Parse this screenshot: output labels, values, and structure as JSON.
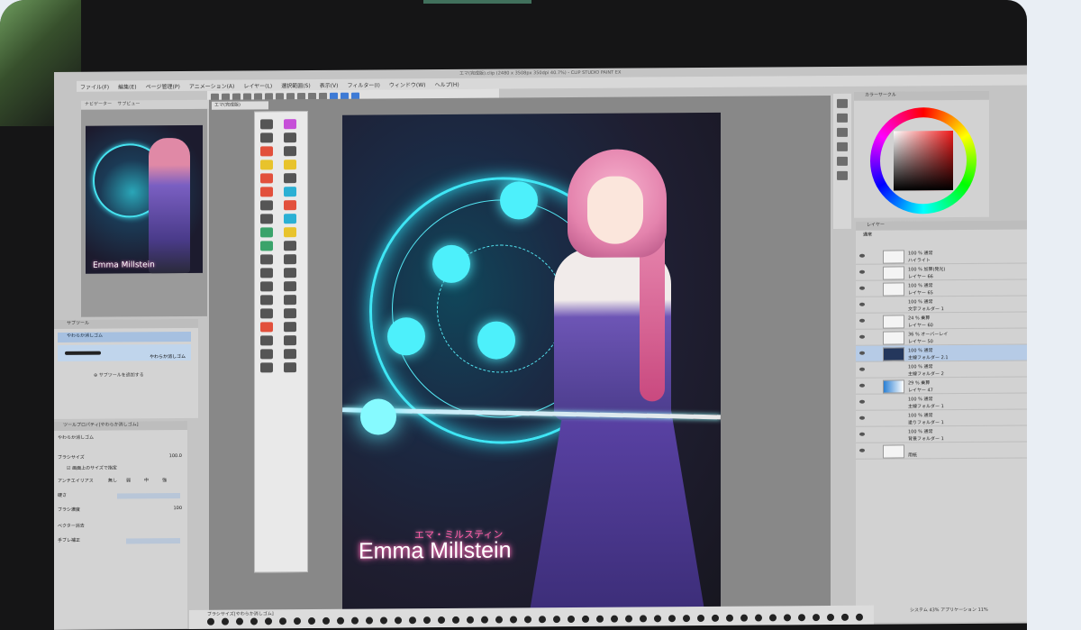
{
  "window": {
    "title": "エマ(完成版).clip (2480 x 3508px 350dpi 40.7%)  - CLIP STUDIO PAINT EX"
  },
  "menubar": {
    "items": [
      "ファイル(F)",
      "編集(E)",
      "ページ管理(P)",
      "アニメーション(A)",
      "レイヤー(L)",
      "選択範囲(S)",
      "表示(V)",
      "フィルター(I)",
      "ウィンドウ(W)",
      "ヘルプ(H)"
    ]
  },
  "navigator": {
    "tabs": [
      "ナビゲーター",
      "サブビュー"
    ],
    "thumb_name": "Emma Millstein"
  },
  "document": {
    "tab": "エマ(完成版)"
  },
  "subtool": {
    "header": "サブツール",
    "selected": "やわらか消しゴム",
    "selected_detail": "やわらか消しゴム",
    "add_button": "サブツールを追加する"
  },
  "tool_property": {
    "header": "ツールプロパティ[やわらか消しゴム]",
    "tool_name": "やわらか消しゴム",
    "brush_size_label": "ブラシサイズ",
    "brush_size_value": "100.0",
    "screen_size_label": "画面上のサイズで指定",
    "antialias_label": "アンチエイリアス",
    "antialias_options": [
      "無し",
      "弱",
      "中",
      "強"
    ],
    "hardness_label": "硬さ",
    "density_label": "ブラシ濃度",
    "density_value": "100",
    "vector_label": "ベクター消去",
    "stabilize_label": "手ブレ補正"
  },
  "artwork": {
    "jp_title": "エマ・ミルスティン",
    "title": "Emma Millstein"
  },
  "color_panel": {
    "header": "カラーサークル"
  },
  "layers": {
    "header": "レイヤー",
    "blend_mode": "通常",
    "rows": [
      {
        "mode": "100 % 通常",
        "name": "ハイライト"
      },
      {
        "mode": "100 % 加算(発光)",
        "name": "レイヤー 66"
      },
      {
        "mode": "100 % 通常",
        "name": "レイヤー 65"
      },
      {
        "mode": "100 % 通常",
        "name": "文字フォルダー 1"
      },
      {
        "mode": "24 % 乗算",
        "name": "レイヤー 60"
      },
      {
        "mode": "36 % オーバーレイ",
        "name": "レイヤー 50"
      },
      {
        "mode": "100 % 通常",
        "name": "主線フォルダー 2.1"
      },
      {
        "mode": "100 % 通常",
        "name": "主線フォルダー 2"
      },
      {
        "mode": "29 % 乗算",
        "name": "レイヤー 47"
      },
      {
        "mode": "100 % 通常",
        "name": "主線フォルダー 1"
      },
      {
        "mode": "100 % 通常",
        "name": "塗りフォルダー 1"
      },
      {
        "mode": "100 % 通常",
        "name": "背景フォルダー 1"
      },
      {
        "mode": "",
        "name": "用紙"
      }
    ]
  },
  "brush_size_bar": {
    "label": "ブラシサイズ[やわらか消しゴム]"
  },
  "status": {
    "text": "システム 43%  アプリケーション 11%"
  }
}
